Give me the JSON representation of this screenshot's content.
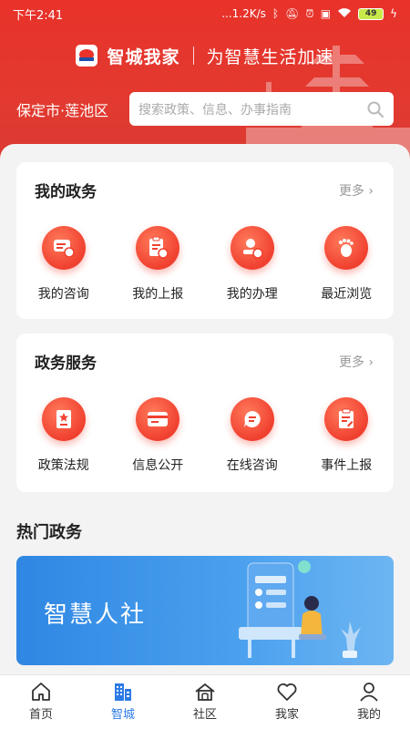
{
  "status_bar": {
    "time": "下午2:41",
    "network_speed": "...1.2K/s",
    "battery": "49"
  },
  "brand": {
    "name": "智城我家",
    "slogan": "为智慧生活加速"
  },
  "location": "保定市·莲池区",
  "search": {
    "placeholder": "搜索政策、信息、办事指南"
  },
  "my_affairs": {
    "title": "我的政务",
    "more": "更多",
    "items": [
      {
        "label": "我的咨询",
        "icon": "consult-icon"
      },
      {
        "label": "我的上报",
        "icon": "report-icon"
      },
      {
        "label": "我的办理",
        "icon": "handle-icon"
      },
      {
        "label": "最近浏览",
        "icon": "footprint-icon"
      }
    ]
  },
  "gov_services": {
    "title": "政务服务",
    "more": "更多",
    "items": [
      {
        "label": "政策法规",
        "icon": "policy-icon"
      },
      {
        "label": "信息公开",
        "icon": "info-card-icon"
      },
      {
        "label": "在线咨询",
        "icon": "chat-icon"
      },
      {
        "label": "事件上报",
        "icon": "clipboard-edit-icon"
      }
    ]
  },
  "hot": {
    "title": "热门政务",
    "banner_text": "智慧人社"
  },
  "tabbar": {
    "items": [
      {
        "label": "首页",
        "icon": "home-icon",
        "active": false
      },
      {
        "label": "智城",
        "icon": "city-icon",
        "active": true
      },
      {
        "label": "社区",
        "icon": "community-icon",
        "active": false
      },
      {
        "label": "我家",
        "icon": "heart-icon",
        "active": false
      },
      {
        "label": "我的",
        "icon": "person-icon",
        "active": false
      }
    ]
  },
  "colors": {
    "primary_red": "#e8322a",
    "accent_blue": "#2d7be5",
    "banner_blue": "#2f87e3"
  }
}
